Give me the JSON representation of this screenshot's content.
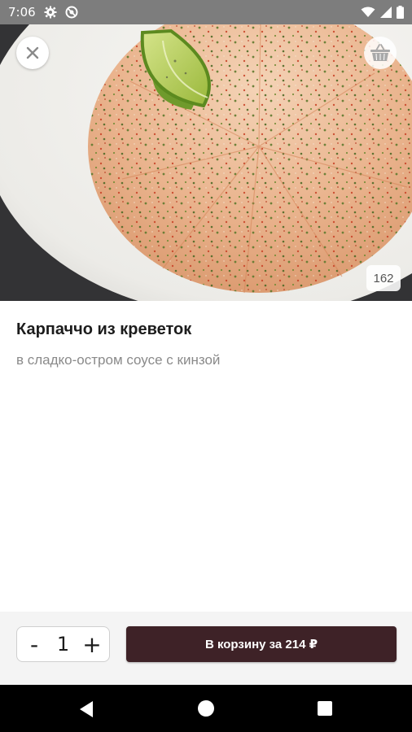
{
  "status_bar": {
    "time": "7:06",
    "icons": [
      "gear-icon",
      "do-not-disturb-icon",
      "wifi-icon",
      "signal-icon",
      "battery-icon"
    ],
    "background": "#7d7d7d"
  },
  "hero": {
    "image": "shrimp-carpaccio-plate",
    "weight": "162"
  },
  "product": {
    "title": "Карпаччо из креветок",
    "description": "в сладко-остром соусе с кинзой"
  },
  "quantity": {
    "minus_label": "-",
    "value": "1",
    "plus_label": "+"
  },
  "cart_button": {
    "label": "В корзину за 214 ₽",
    "color": "#3e2227"
  },
  "nav_bar": {
    "icons": [
      "back-icon",
      "home-icon",
      "recents-icon"
    ]
  }
}
